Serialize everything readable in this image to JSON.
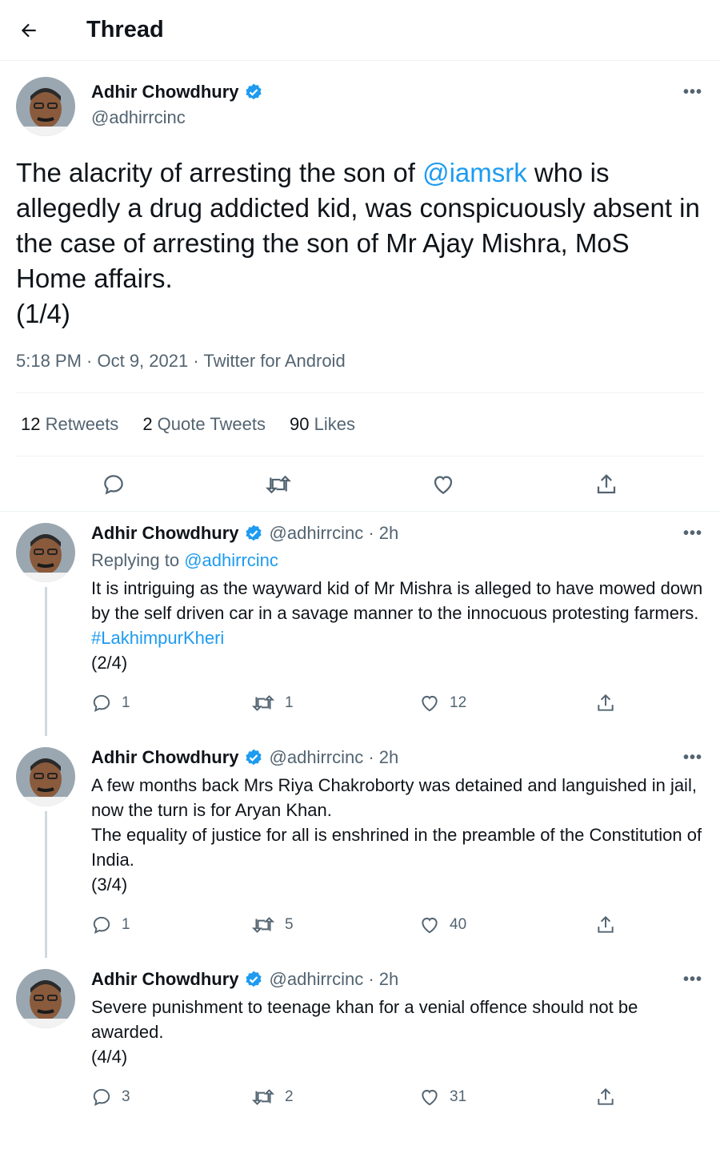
{
  "header": {
    "title": "Thread"
  },
  "main_tweet": {
    "name": "Adhir Chowdhury",
    "handle": "@adhirrcinc",
    "text_before": "The alacrity of arresting the son of ",
    "mention": "@iamsrk",
    "text_after": " who is allegedly a drug addicted kid, was conspicuously absent in the case of arresting the son of Mr Ajay Mishra, MoS Home affairs.",
    "part": "(1/4)",
    "meta": "5:18 PM · Oct 9, 2021 · Twitter for Android",
    "retweets_count": "12",
    "retweets_label": " Retweets",
    "quotes_count": "2",
    "quotes_label": " Quote Tweets",
    "likes_count": "90",
    "likes_label": " Likes"
  },
  "replies": [
    {
      "name": "Adhir Chowdhury",
      "handle_time": "@adhirrcinc · 2h",
      "replying_prefix": "Replying to ",
      "replying_handle": "@adhirrcinc",
      "text": "It is intriguing as the wayward kid of Mr Mishra is alleged to have mowed down by the self driven car in a savage manner to the innocuous protesting farmers.",
      "hashtag": "#LakhimpurKheri",
      "part": "(2/4)",
      "replies": "1",
      "retweets": "1",
      "likes": "12"
    },
    {
      "name": "Adhir Chowdhury",
      "handle_time": "@adhirrcinc · 2h",
      "text1": "A few months back Mrs Riya Chakroborty was detained and languished in jail, now the turn is for Aryan Khan.",
      "text2": "The equality of justice for all is enshrined in the preamble of the Constitution of India.",
      "part": "(3/4)",
      "replies": "1",
      "retweets": "5",
      "likes": "40"
    },
    {
      "name": "Adhir Chowdhury",
      "handle_time": "@adhirrcinc · 2h",
      "text": "Severe punishment to teenage khan for a venial offence should not be awarded.",
      "part": "(4/4)",
      "replies": "3",
      "retweets": "2",
      "likes": "31"
    }
  ],
  "colors": {
    "accent": "#1d9bf0",
    "muted": "#536471",
    "text": "#0f1419"
  }
}
